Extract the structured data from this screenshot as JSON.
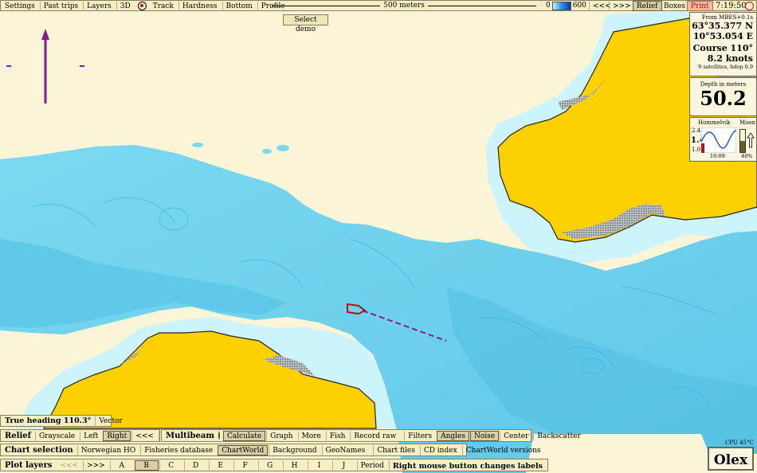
{
  "top_bar": {
    "items": [
      "Settings",
      "Past trips",
      "Layers",
      "3D",
      "Track",
      "Hardness",
      "Bottom",
      "Profile"
    ],
    "scale_label": "500 meters",
    "depth_scale_min": "0",
    "depth_scale_max": "600",
    "nav_back": "<<<",
    "nav_fwd": ">>>",
    "relief": "Relief",
    "boxes": "Boxes",
    "print": "Print",
    "clock": "7:19:50"
  },
  "select_demo": "Select demo",
  "position_panel": {
    "source": "From MBES+0.1s",
    "lat": "63°35.377 N",
    "lon": "10°53.054 E",
    "course": "Course 110°",
    "speed": "8.2 knots",
    "satellites": "9 satellites, hdop 0.9"
  },
  "depth_panel": {
    "label": "Depth in meters",
    "value": "50.2"
  },
  "tide_panel": {
    "place": "Hommelvik",
    "moon": "Moon",
    "max": "2.4",
    "current": "1.4",
    "min": "1.0",
    "time": "10:09",
    "moon_pct": "48%"
  },
  "heading_bar": {
    "heading": "True heading 110.3°",
    "vector": "Vector"
  },
  "relief_row": {
    "label": "Relief",
    "items": [
      "Grayscale",
      "Left",
      "Right",
      "<<<",
      ">>>"
    ],
    "active": "Right"
  },
  "multibeam_row": {
    "label": "Multibeam",
    "items": [
      "Calculate",
      "Graph",
      "More",
      "Fish",
      "Record raw",
      "Filters",
      "Angles",
      "Noise",
      "Center",
      "Backscatter"
    ],
    "active": [
      "Calculate",
      "Angles",
      "Noise"
    ]
  },
  "chart_row": {
    "label": "Chart selection",
    "items": [
      "Norwegian HO",
      "Fisheries database",
      "ChartWorld",
      "Background",
      "GeoNames",
      "Chart files",
      "CD index",
      "ChartWorld versions"
    ],
    "active": "ChartWorld"
  },
  "plot_row": {
    "label": "Plot layers",
    "items": [
      "<<<",
      ">>>",
      "A",
      "B",
      "C",
      "D",
      "E",
      "F",
      "G",
      "H",
      "I",
      "J",
      "Period"
    ],
    "active": "B",
    "hint": "Right mouse button changes labels"
  },
  "status": {
    "cpu": "CPU 45°C",
    "brand": "Olex"
  },
  "colors": {
    "land": "#fdd000",
    "shallow": "#cef4fb",
    "seabed": "#6fd3ef",
    "background": "#fbf5d8",
    "track": "#8b1a8b",
    "vessel": "#b3121f"
  }
}
